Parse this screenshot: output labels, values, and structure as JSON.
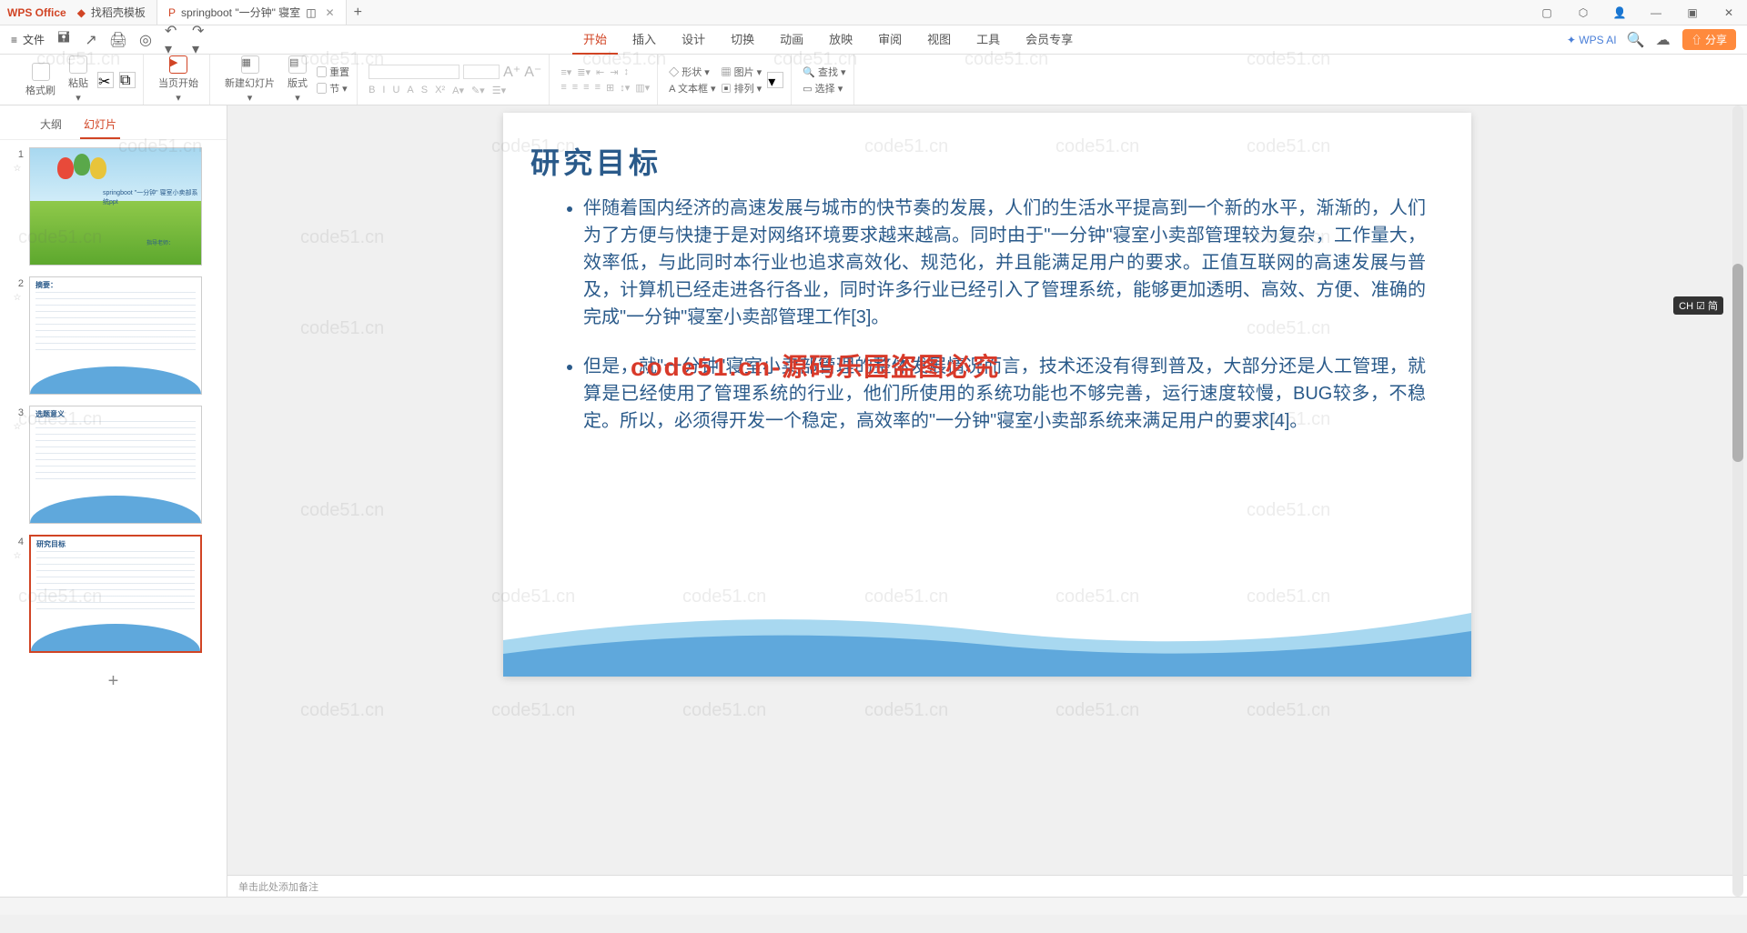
{
  "titlebar": {
    "app_name": "WPS Office",
    "tabs": [
      {
        "label": "找稻壳模板",
        "icon": "doc"
      },
      {
        "label": "springboot \"一分钟\" 寝室",
        "icon": "ppt",
        "active": true
      }
    ],
    "win_icons": [
      "box",
      "cube",
      "user",
      "min",
      "max",
      "close"
    ]
  },
  "menubar": {
    "file": "文件",
    "tabs": [
      "开始",
      "插入",
      "设计",
      "切换",
      "动画",
      "放映",
      "审阅",
      "视图",
      "工具",
      "会员专享"
    ],
    "active_tab": "开始",
    "wps_ai": "WPS AI",
    "share": "分享"
  },
  "ribbon": {
    "format_painter": "格式刷",
    "paste": "粘贴",
    "from_current": "当页开始",
    "new_slide": "新建幻灯片",
    "layout": "版式",
    "section": "节",
    "reset": "重置",
    "shape": "形状",
    "picture": "图片",
    "textbox": "文本框",
    "arrange": "排列",
    "find": "查找",
    "select": "选择"
  },
  "panel": {
    "tabs": [
      "大纲",
      "幻灯片"
    ],
    "active": "幻灯片",
    "slides": [
      {
        "num": "1",
        "title": "springboot \"一分钟\" 寝室小卖部系统ppt",
        "subtitle": "指导老师："
      },
      {
        "num": "2",
        "title": "摘要："
      },
      {
        "num": "3",
        "title": "选题意义"
      },
      {
        "num": "4",
        "title": "研究目标"
      }
    ]
  },
  "slide": {
    "title": "研究目标",
    "bullets": [
      "伴随着国内经济的高速发展与城市的快节奏的发展，人们的生活水平提高到一个新的水平，渐渐的，人们为了方便与快捷于是对网络环境要求越来越高。同时由于\"一分钟\"寝室小卖部管理较为复杂，工作量大，效率低，与此同时本行业也追求高效化、规范化，并且能满足用户的要求。正值互联网的高速发展与普及，计算机已经走进各行各业，同时许多行业已经引入了管理系统，能够更加透明、高效、方便、准确的完成\"一分钟\"寝室小卖部管理工作[3]。",
      "但是，就\"一分钟\"寝室小卖部管理的整体发展情况而言，技术还没有得到普及，大部分还是人工管理，就算是已经使用了管理系统的行业，他们所使用的系统功能也不够完善，运行速度较慢，BUG较多，不稳定。所以，必须得开发一个稳定，高效率的\"一分钟\"寝室小卖部系统来满足用户的要求[4]。"
    ],
    "overlay_watermark": "code51.cn-源码乐园盗图必究"
  },
  "notes_placeholder": "单击此处添加备注",
  "lang_badge": "CH ☑ 简",
  "watermarks": [
    "code51.cn"
  ]
}
